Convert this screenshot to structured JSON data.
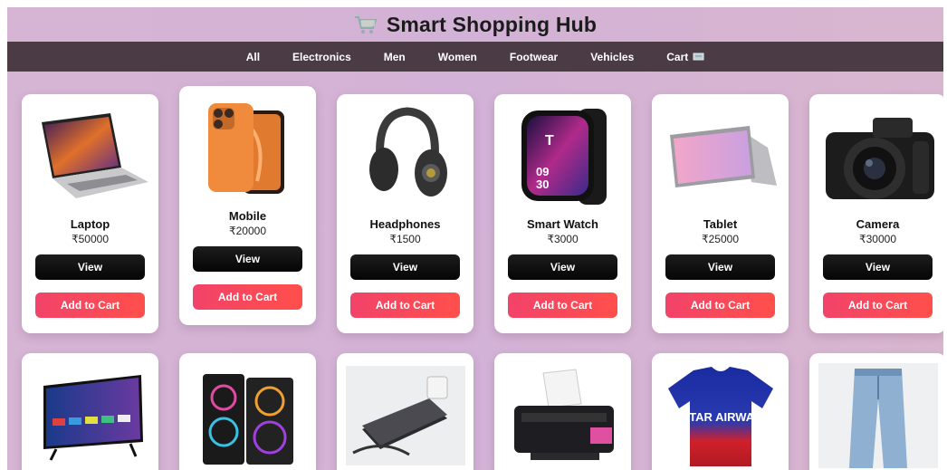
{
  "header": {
    "title": "Smart Shopping Hub",
    "logo_icon": "shopping-cart-icon"
  },
  "nav": {
    "items": [
      "All",
      "Electronics",
      "Men",
      "Women",
      "Footwear",
      "Vehicles"
    ],
    "cart_label": "Cart",
    "cart_icon": "cart-icon"
  },
  "products": [
    {
      "name": "Laptop",
      "price": "₹50000",
      "view_label": "View",
      "add_label": "Add to Cart"
    },
    {
      "name": "Mobile",
      "price": "₹20000",
      "view_label": "View",
      "add_label": "Add to Cart"
    },
    {
      "name": "Headphones",
      "price": "₹1500",
      "view_label": "View",
      "add_label": "Add to Cart"
    },
    {
      "name": "Smart Watch",
      "price": "₹3000",
      "view_label": "View",
      "add_label": "Add to Cart",
      "watch_time": "09 30"
    },
    {
      "name": "Tablet",
      "price": "₹25000",
      "view_label": "View",
      "add_label": "Add to Cart"
    },
    {
      "name": "Camera",
      "price": "₹30000",
      "view_label": "View",
      "add_label": "Add to Cart"
    }
  ],
  "row2_images": [
    "tv-image",
    "speakers-image",
    "power-bank-image",
    "printer-image",
    "jersey-image",
    "jeans-image"
  ],
  "jersey_text": "QATAR AIRWAYS",
  "colors": {
    "nav_bg": "#4a3b45",
    "view_btn": "#111111",
    "add_btn": "#f2436a",
    "page_bg": "#d4b4d4"
  }
}
